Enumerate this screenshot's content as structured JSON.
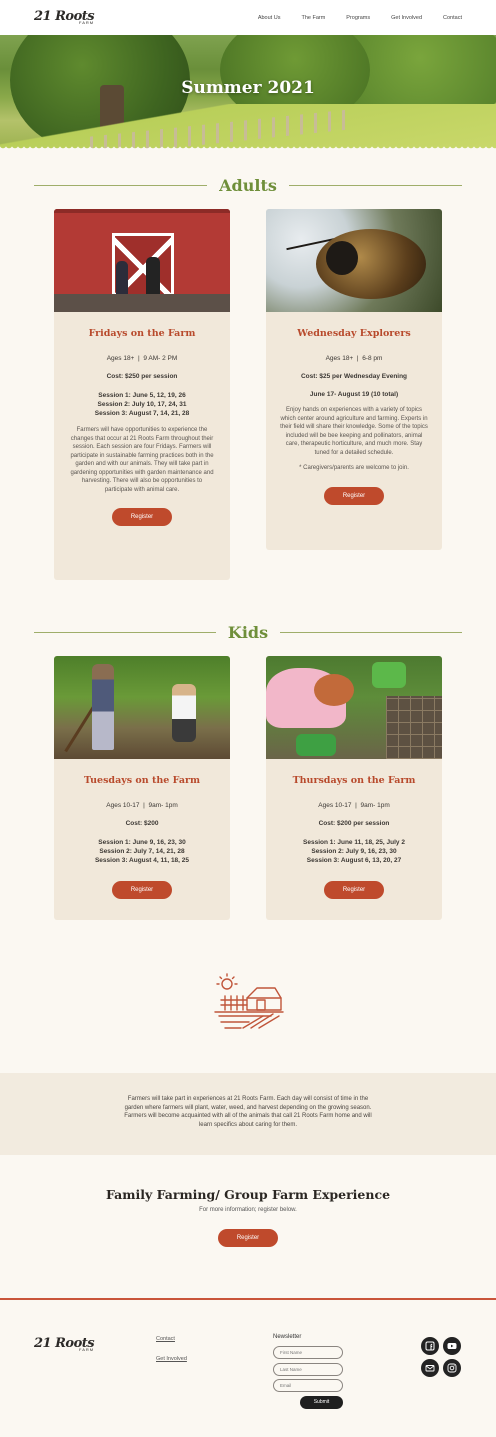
{
  "header": {
    "logo_main": "21 Roots",
    "logo_sub": "FARM",
    "nav": [
      "About Us",
      "The Farm",
      "Programs",
      "Get Involved",
      "Contact"
    ]
  },
  "hero": {
    "title": "Summer 2021"
  },
  "adults": {
    "heading": "Adults",
    "cards": [
      {
        "title": "Fridays on the Farm",
        "ages": "Ages 18+",
        "sep": "|",
        "time": "9 AM- 2 PM",
        "cost": "Cost: $250 per session",
        "sessions": [
          "Session 1: June 5, 12, 19, 26",
          "Session 2: July 10, 17, 24, 31",
          "Session 3: August 7, 14, 21, 28"
        ],
        "desc": "Farmers will have opportunities to experience the changes that occur at 21 Roots Farm throughout their session. Each session are four Fridays. Farmers will participate in sustainable farming practices both in the garden and with our animals. They will take part in gardening opportunities with garden maintenance and harvesting. There will also be opportunities to participate with animal care.",
        "button": "Register"
      },
      {
        "title": "Wednesday Explorers",
        "ages": "Ages 18+",
        "sep": "|",
        "time": "6-8 pm",
        "cost": "Cost: $25 per Wednesday Evening",
        "dates": "June 17- August 19 (10 total)",
        "desc": "Enjoy hands on experiences with a variety of topics which center around agriculture and farming.  Experts in their field will share their knowledge. Some of the topics included will be bee keeping and pollinators, animal care, therapeutic horticulture, and much more. Stay tuned for a detailed schedule.",
        "note": "* Caregivers/parents are welcome to join.",
        "button": "Register"
      }
    ]
  },
  "kids": {
    "heading": "Kids",
    "cards": [
      {
        "title": "Tuesdays on the Farm",
        "ages": "Ages 10-17",
        "sep": "|",
        "time": "9am- 1pm",
        "cost": "Cost: $200",
        "sessions": [
          "Session 1:  June 9, 16, 23, 30",
          "Session 2: July 7, 14, 21, 28",
          "Session 3: August 4, 11, 18, 25"
        ],
        "button": "Register"
      },
      {
        "title": "Thursdays on the Farm",
        "ages": "Ages 10-17",
        "sep": "|",
        "time": "9am- 1pm",
        "cost": "Cost: $200 per session",
        "sessions": [
          "Session 1: June 11, 18, 25, July 2",
          "Session 2: July  9, 16, 23, 30",
          "Session 3: August 6, 13, 20, 27"
        ],
        "button": "Register"
      }
    ]
  },
  "band": {
    "text": "Farmers will take part in experiences at 21 Roots Farm.  Each day will consist of time in the garden where farmers  will plant, water, weed, and harvest depending on the growing season. Farmers will become acquainted with all of the animals that call 21 Roots Farm home and will learn specifics about caring for them."
  },
  "family": {
    "title": "Family Farming/ Group Farm Experience",
    "subtitle": "For more information; register below.",
    "button": "Register"
  },
  "footer": {
    "logo_main": "21 Roots",
    "logo_sub": "FARM",
    "links": [
      "Contact",
      "Get Involved"
    ],
    "newsletter_label": "Newsletter",
    "first_name_placeholder": "First Name",
    "last_name_placeholder": "Last Name",
    "email_placeholder": "Email",
    "submit": "Submit",
    "social_icons": [
      "facebook-icon",
      "youtube-icon",
      "email-icon",
      "instagram-icon"
    ]
  },
  "colors": {
    "accent": "#bf4a2c",
    "green": "#6f8f3a",
    "card": "#f1e8da",
    "background": "#fbf8f2"
  }
}
